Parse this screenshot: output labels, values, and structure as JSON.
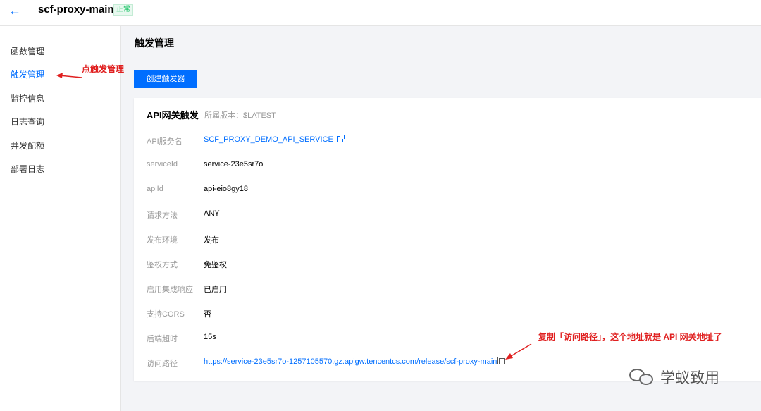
{
  "header": {
    "back_icon": "arrow-left-icon",
    "function_name": "scf-proxy-main",
    "status": "正常"
  },
  "sidebar": {
    "items": [
      {
        "label": "函数管理"
      },
      {
        "label": "触发管理"
      },
      {
        "label": "监控信息"
      },
      {
        "label": "日志查询"
      },
      {
        "label": "并发配额"
      },
      {
        "label": "部署日志"
      }
    ]
  },
  "annotations": {
    "click_trigger": "点触发管理",
    "copy_path": "复制「访问路径」，这个地址就是 API 网关地址了"
  },
  "main": {
    "title": "触发管理",
    "create_button": "创建触发器",
    "card": {
      "title": "API网关触发",
      "version": "所属版本：$LATEST",
      "rows": [
        {
          "label": "API服务名",
          "value": "SCF_PROXY_DEMO_API_SERVICE"
        },
        {
          "label": "serviceId",
          "value": "service-23e5sr7o"
        },
        {
          "label": "apiId",
          "value": "api-eio8gy18"
        },
        {
          "label": "请求方法",
          "value": "ANY"
        },
        {
          "label": "发布环境",
          "value": "发布"
        },
        {
          "label": "鉴权方式",
          "value": "免鉴权"
        },
        {
          "label": "启用集成响应",
          "value": "已启用"
        },
        {
          "label": "支持CORS",
          "value": "否"
        },
        {
          "label": "后端超时",
          "value": "15s"
        },
        {
          "label": "访问路径",
          "value": "https://service-23e5sr7o-1257105570.gz.apigw.tencentcs.com/release/scf-proxy-main"
        }
      ]
    }
  },
  "watermark": "学蚁致用",
  "colors": {
    "accent": "#006eff",
    "status_green": "#0abf5b",
    "annotation_red": "#e02020"
  }
}
